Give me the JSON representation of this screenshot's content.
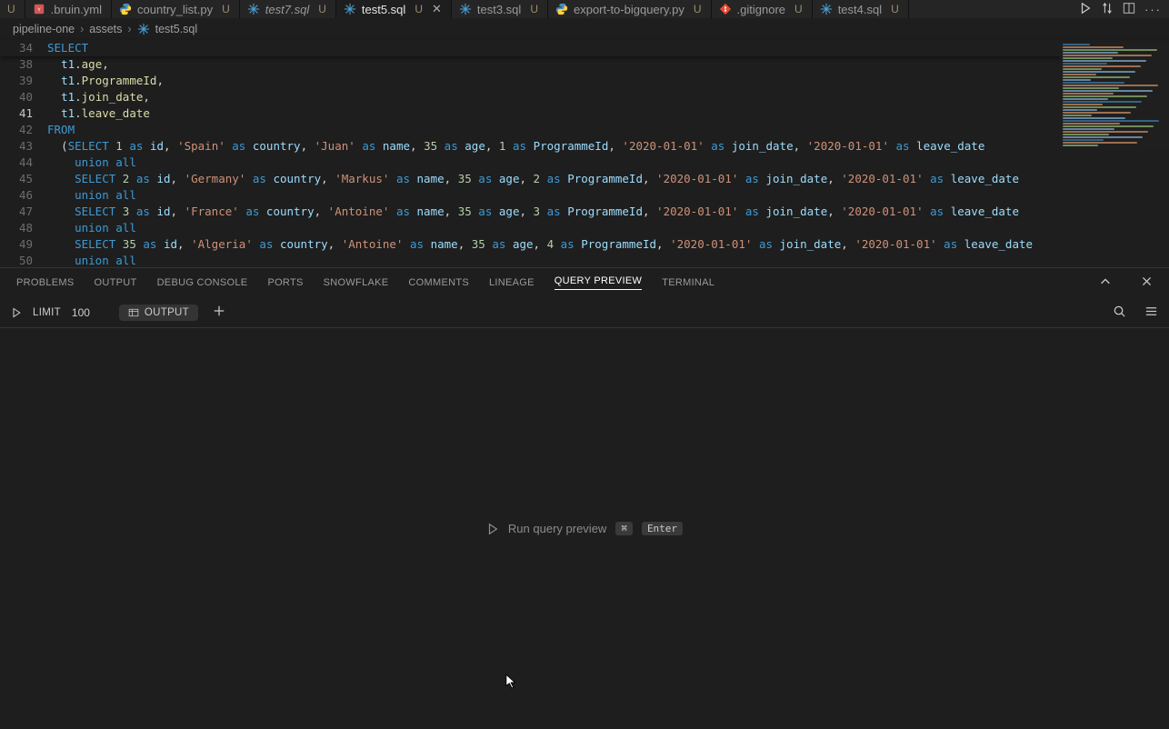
{
  "tabs": [
    {
      "name": "",
      "status": "U",
      "icon": "none",
      "startcut": true
    },
    {
      "name": ".bruin.yml",
      "status": "",
      "icon": "yaml"
    },
    {
      "name": "country_list.py",
      "status": "U",
      "icon": "python"
    },
    {
      "name": "test7.sql",
      "status": "U",
      "icon": "snowflake",
      "italic": true
    },
    {
      "name": "test5.sql",
      "status": "U",
      "icon": "snowflake",
      "active": true,
      "close": true
    },
    {
      "name": "test3.sql",
      "status": "U",
      "icon": "snowflake"
    },
    {
      "name": "export-to-bigquery.py",
      "status": "U",
      "icon": "python"
    },
    {
      "name": ".gitignore",
      "status": "U",
      "icon": "git"
    },
    {
      "name": "test4.sql",
      "status": "U",
      "icon": "snowflake"
    }
  ],
  "breadcrumb": {
    "part1": "pipeline-one",
    "part2": "assets",
    "part3": "test5.sql"
  },
  "editor": {
    "sticky_line_no": "34",
    "sticky_tokens": [
      {
        "t": "SELECT",
        "c": "kw"
      }
    ],
    "lines": [
      {
        "no": 38,
        "indent": 1,
        "tokens": [
          {
            "t": "t1",
            "c": "col"
          },
          {
            "t": ".",
            "c": "pun"
          },
          {
            "t": "age",
            "c": "fn"
          },
          {
            "t": ",",
            "c": "pun"
          }
        ]
      },
      {
        "no": 39,
        "indent": 1,
        "tokens": [
          {
            "t": "t1",
            "c": "col"
          },
          {
            "t": ".",
            "c": "pun"
          },
          {
            "t": "ProgrammeId",
            "c": "fn"
          },
          {
            "t": ",",
            "c": "pun"
          }
        ]
      },
      {
        "no": 40,
        "indent": 1,
        "tokens": [
          {
            "t": "t1",
            "c": "col"
          },
          {
            "t": ".",
            "c": "pun"
          },
          {
            "t": "join_date",
            "c": "fn"
          },
          {
            "t": ",",
            "c": "pun"
          }
        ]
      },
      {
        "no": 41,
        "indent": 1,
        "current": true,
        "tokens": [
          {
            "t": "t1",
            "c": "col"
          },
          {
            "t": ".",
            "c": "pun"
          },
          {
            "t": "leave_date",
            "c": "fn"
          }
        ]
      },
      {
        "no": 42,
        "indent": 0,
        "tokens": [
          {
            "t": "FROM",
            "c": "kw"
          }
        ]
      },
      {
        "no": 43,
        "indent": 1,
        "tokens": [
          {
            "t": "(",
            "c": "pun"
          },
          {
            "t": "SELECT",
            "c": "kw"
          },
          {
            "t": " ",
            "c": "pun"
          },
          {
            "t": "1",
            "c": "num"
          },
          {
            "t": " ",
            "c": "pun"
          },
          {
            "t": "as",
            "c": "kw"
          },
          {
            "t": " ",
            "c": "pun"
          },
          {
            "t": "id",
            "c": "col"
          },
          {
            "t": ", ",
            "c": "pun"
          },
          {
            "t": "'Spain'",
            "c": "str"
          },
          {
            "t": " ",
            "c": "pun"
          },
          {
            "t": "as",
            "c": "kw"
          },
          {
            "t": " ",
            "c": "pun"
          },
          {
            "t": "country",
            "c": "col"
          },
          {
            "t": ", ",
            "c": "pun"
          },
          {
            "t": "'Juan'",
            "c": "str"
          },
          {
            "t": " ",
            "c": "pun"
          },
          {
            "t": "as",
            "c": "kw"
          },
          {
            "t": " ",
            "c": "pun"
          },
          {
            "t": "name",
            "c": "col"
          },
          {
            "t": ", ",
            "c": "pun"
          },
          {
            "t": "35",
            "c": "num"
          },
          {
            "t": " ",
            "c": "pun"
          },
          {
            "t": "as",
            "c": "kw"
          },
          {
            "t": " ",
            "c": "pun"
          },
          {
            "t": "age",
            "c": "col"
          },
          {
            "t": ", ",
            "c": "pun"
          },
          {
            "t": "1",
            "c": "num"
          },
          {
            "t": " ",
            "c": "pun"
          },
          {
            "t": "as",
            "c": "kw"
          },
          {
            "t": " ",
            "c": "pun"
          },
          {
            "t": "ProgrammeId",
            "c": "col"
          },
          {
            "t": ", ",
            "c": "pun"
          },
          {
            "t": "'2020-01-01'",
            "c": "str"
          },
          {
            "t": " ",
            "c": "pun"
          },
          {
            "t": "as",
            "c": "kw"
          },
          {
            "t": " ",
            "c": "pun"
          },
          {
            "t": "join_date",
            "c": "col"
          },
          {
            "t": ", ",
            "c": "pun"
          },
          {
            "t": "'2020-01-01'",
            "c": "str"
          },
          {
            "t": " ",
            "c": "pun"
          },
          {
            "t": "as",
            "c": "kw"
          },
          {
            "t": " ",
            "c": "pun"
          },
          {
            "t": "leave_date",
            "c": "col"
          }
        ]
      },
      {
        "no": 44,
        "indent": 2,
        "tokens": [
          {
            "t": "union",
            "c": "kw"
          },
          {
            "t": " ",
            "c": "pun"
          },
          {
            "t": "all",
            "c": "kw"
          }
        ]
      },
      {
        "no": 45,
        "indent": 2,
        "tokens": [
          {
            "t": "SELECT",
            "c": "kw"
          },
          {
            "t": " ",
            "c": "pun"
          },
          {
            "t": "2",
            "c": "num"
          },
          {
            "t": " ",
            "c": "pun"
          },
          {
            "t": "as",
            "c": "kw"
          },
          {
            "t": " ",
            "c": "pun"
          },
          {
            "t": "id",
            "c": "col"
          },
          {
            "t": ", ",
            "c": "pun"
          },
          {
            "t": "'Germany'",
            "c": "str"
          },
          {
            "t": " ",
            "c": "pun"
          },
          {
            "t": "as",
            "c": "kw"
          },
          {
            "t": " ",
            "c": "pun"
          },
          {
            "t": "country",
            "c": "col"
          },
          {
            "t": ", ",
            "c": "pun"
          },
          {
            "t": "'Markus'",
            "c": "str"
          },
          {
            "t": " ",
            "c": "pun"
          },
          {
            "t": "as",
            "c": "kw"
          },
          {
            "t": " ",
            "c": "pun"
          },
          {
            "t": "name",
            "c": "col"
          },
          {
            "t": ", ",
            "c": "pun"
          },
          {
            "t": "35",
            "c": "num"
          },
          {
            "t": " ",
            "c": "pun"
          },
          {
            "t": "as",
            "c": "kw"
          },
          {
            "t": " ",
            "c": "pun"
          },
          {
            "t": "age",
            "c": "col"
          },
          {
            "t": ", ",
            "c": "pun"
          },
          {
            "t": "2",
            "c": "num"
          },
          {
            "t": " ",
            "c": "pun"
          },
          {
            "t": "as",
            "c": "kw"
          },
          {
            "t": " ",
            "c": "pun"
          },
          {
            "t": "ProgrammeId",
            "c": "col"
          },
          {
            "t": ", ",
            "c": "pun"
          },
          {
            "t": "'2020-01-01'",
            "c": "str"
          },
          {
            "t": " ",
            "c": "pun"
          },
          {
            "t": "as",
            "c": "kw"
          },
          {
            "t": " ",
            "c": "pun"
          },
          {
            "t": "join_date",
            "c": "col"
          },
          {
            "t": ", ",
            "c": "pun"
          },
          {
            "t": "'2020-01-01'",
            "c": "str"
          },
          {
            "t": " ",
            "c": "pun"
          },
          {
            "t": "as",
            "c": "kw"
          },
          {
            "t": " ",
            "c": "pun"
          },
          {
            "t": "leave_date",
            "c": "col"
          }
        ]
      },
      {
        "no": 46,
        "indent": 2,
        "tokens": [
          {
            "t": "union",
            "c": "kw"
          },
          {
            "t": " ",
            "c": "pun"
          },
          {
            "t": "all",
            "c": "kw"
          }
        ]
      },
      {
        "no": 47,
        "indent": 2,
        "tokens": [
          {
            "t": "SELECT",
            "c": "kw"
          },
          {
            "t": " ",
            "c": "pun"
          },
          {
            "t": "3",
            "c": "num"
          },
          {
            "t": " ",
            "c": "pun"
          },
          {
            "t": "as",
            "c": "kw"
          },
          {
            "t": " ",
            "c": "pun"
          },
          {
            "t": "id",
            "c": "col"
          },
          {
            "t": ", ",
            "c": "pun"
          },
          {
            "t": "'France'",
            "c": "str"
          },
          {
            "t": " ",
            "c": "pun"
          },
          {
            "t": "as",
            "c": "kw"
          },
          {
            "t": " ",
            "c": "pun"
          },
          {
            "t": "country",
            "c": "col"
          },
          {
            "t": ", ",
            "c": "pun"
          },
          {
            "t": "'Antoine'",
            "c": "str"
          },
          {
            "t": " ",
            "c": "pun"
          },
          {
            "t": "as",
            "c": "kw"
          },
          {
            "t": " ",
            "c": "pun"
          },
          {
            "t": "name",
            "c": "col"
          },
          {
            "t": ", ",
            "c": "pun"
          },
          {
            "t": "35",
            "c": "num"
          },
          {
            "t": " ",
            "c": "pun"
          },
          {
            "t": "as",
            "c": "kw"
          },
          {
            "t": " ",
            "c": "pun"
          },
          {
            "t": "age",
            "c": "col"
          },
          {
            "t": ", ",
            "c": "pun"
          },
          {
            "t": "3",
            "c": "num"
          },
          {
            "t": " ",
            "c": "pun"
          },
          {
            "t": "as",
            "c": "kw"
          },
          {
            "t": " ",
            "c": "pun"
          },
          {
            "t": "ProgrammeId",
            "c": "col"
          },
          {
            "t": ", ",
            "c": "pun"
          },
          {
            "t": "'2020-01-01'",
            "c": "str"
          },
          {
            "t": " ",
            "c": "pun"
          },
          {
            "t": "as",
            "c": "kw"
          },
          {
            "t": " ",
            "c": "pun"
          },
          {
            "t": "join_date",
            "c": "col"
          },
          {
            "t": ", ",
            "c": "pun"
          },
          {
            "t": "'2020-01-01'",
            "c": "str"
          },
          {
            "t": " ",
            "c": "pun"
          },
          {
            "t": "as",
            "c": "kw"
          },
          {
            "t": " ",
            "c": "pun"
          },
          {
            "t": "leave_date",
            "c": "col"
          }
        ]
      },
      {
        "no": 48,
        "indent": 2,
        "tokens": [
          {
            "t": "union",
            "c": "kw"
          },
          {
            "t": " ",
            "c": "pun"
          },
          {
            "t": "all",
            "c": "kw"
          }
        ]
      },
      {
        "no": 49,
        "indent": 2,
        "tokens": [
          {
            "t": "SELECT",
            "c": "kw"
          },
          {
            "t": " ",
            "c": "pun"
          },
          {
            "t": "35",
            "c": "num"
          },
          {
            "t": " ",
            "c": "pun"
          },
          {
            "t": "as",
            "c": "kw"
          },
          {
            "t": " ",
            "c": "pun"
          },
          {
            "t": "id",
            "c": "col"
          },
          {
            "t": ", ",
            "c": "pun"
          },
          {
            "t": "'Algeria'",
            "c": "str"
          },
          {
            "t": " ",
            "c": "pun"
          },
          {
            "t": "as",
            "c": "kw"
          },
          {
            "t": " ",
            "c": "pun"
          },
          {
            "t": "country",
            "c": "col"
          },
          {
            "t": ", ",
            "c": "pun"
          },
          {
            "t": "'Antoine'",
            "c": "str"
          },
          {
            "t": " ",
            "c": "pun"
          },
          {
            "t": "as",
            "c": "kw"
          },
          {
            "t": " ",
            "c": "pun"
          },
          {
            "t": "name",
            "c": "col"
          },
          {
            "t": ", ",
            "c": "pun"
          },
          {
            "t": "35",
            "c": "num"
          },
          {
            "t": " ",
            "c": "pun"
          },
          {
            "t": "as",
            "c": "kw"
          },
          {
            "t": " ",
            "c": "pun"
          },
          {
            "t": "age",
            "c": "col"
          },
          {
            "t": ", ",
            "c": "pun"
          },
          {
            "t": "4",
            "c": "num"
          },
          {
            "t": " ",
            "c": "pun"
          },
          {
            "t": "as",
            "c": "kw"
          },
          {
            "t": " ",
            "c": "pun"
          },
          {
            "t": "ProgrammeId",
            "c": "col"
          },
          {
            "t": ", ",
            "c": "pun"
          },
          {
            "t": "'2020-01-01'",
            "c": "str"
          },
          {
            "t": " ",
            "c": "pun"
          },
          {
            "t": "as",
            "c": "kw"
          },
          {
            "t": " ",
            "c": "pun"
          },
          {
            "t": "join_date",
            "c": "col"
          },
          {
            "t": ", ",
            "c": "pun"
          },
          {
            "t": "'2020-01-01'",
            "c": "str"
          },
          {
            "t": " ",
            "c": "pun"
          },
          {
            "t": "as",
            "c": "kw"
          },
          {
            "t": " ",
            "c": "pun"
          },
          {
            "t": "leave_date",
            "c": "col"
          }
        ]
      },
      {
        "no": 50,
        "indent": 2,
        "tokens": [
          {
            "t": "union",
            "c": "kw"
          },
          {
            "t": " ",
            "c": "pun"
          },
          {
            "t": "all",
            "c": "kw"
          }
        ]
      }
    ]
  },
  "panel": {
    "tabs": [
      "PROBLEMS",
      "OUTPUT",
      "DEBUG CONSOLE",
      "PORTS",
      "SNOWFLAKE",
      "COMMENTS",
      "LINEAGE",
      "QUERY PREVIEW",
      "TERMINAL"
    ],
    "active_tab": "QUERY PREVIEW",
    "toolbar": {
      "limit_label": "LIMIT",
      "limit_value": "100",
      "output_label": "OUTPUT"
    },
    "hint": {
      "text": "Run query preview",
      "kbd1": "⌘",
      "kbd2": "Enter"
    }
  }
}
